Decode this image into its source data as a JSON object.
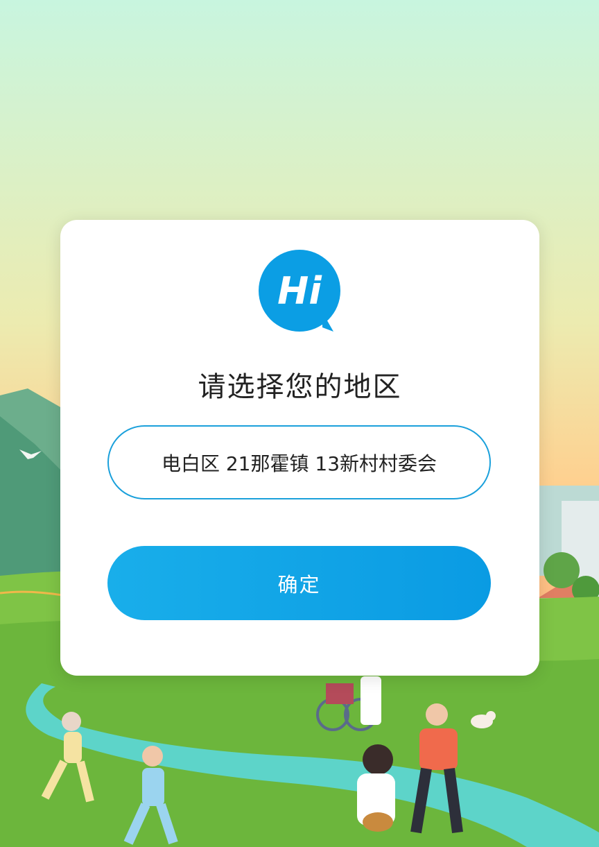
{
  "dialog": {
    "logo_text": "Hi",
    "title": "请选择您的地区",
    "region_value": "电白区 21那霍镇 13新村村委会",
    "confirm_label": "确定"
  },
  "colors": {
    "accent": "#0a9be3",
    "field_border": "#1aa0db",
    "logo": "#0b9ee4"
  },
  "icons": {
    "logo": "hi-chat-bubble-icon"
  }
}
